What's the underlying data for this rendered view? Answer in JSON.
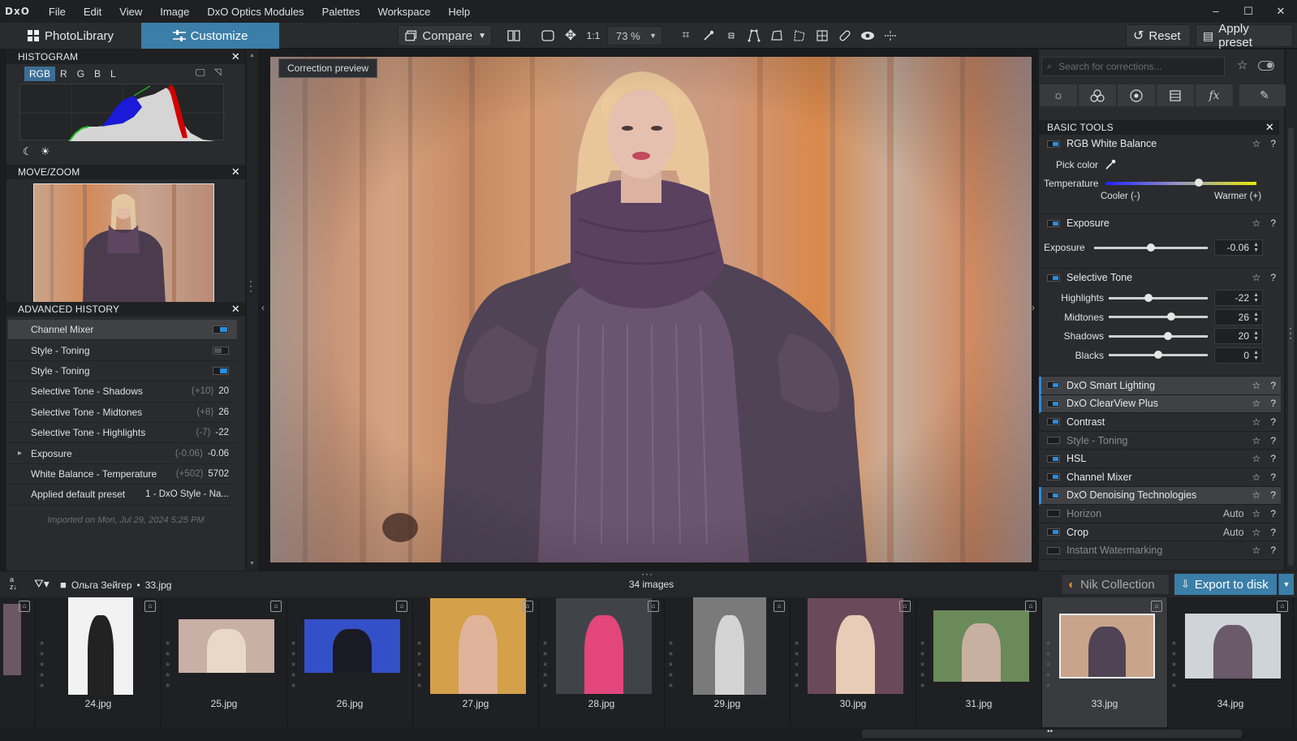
{
  "app": {
    "logo": "DxO"
  },
  "menu": [
    "File",
    "Edit",
    "View",
    "Image",
    "DxO Optics Modules",
    "Palettes",
    "Workspace",
    "Help"
  ],
  "window_controls": [
    "–",
    "☐",
    "✕"
  ],
  "toolbar": {
    "photolibrary": "PhotoLibrary",
    "customize": "Customize",
    "compare": "Compare",
    "one_to_one": "1:1",
    "zoom": "73 %",
    "reset": "Reset",
    "apply_preset": "Apply preset"
  },
  "histogram": {
    "title": "HISTOGRAM",
    "channels": [
      "RGB",
      "R",
      "G",
      "B",
      "L"
    ]
  },
  "movezoom": {
    "title": "MOVE/ZOOM"
  },
  "history": {
    "title": "ADVANCED HISTORY",
    "items": [
      {
        "name": "Channel Mixer",
        "delta": "",
        "value": "",
        "toggle": "on"
      },
      {
        "name": "Style - Toning",
        "delta": "",
        "value": "",
        "toggle": "off"
      },
      {
        "name": "Style - Toning",
        "delta": "",
        "value": "",
        "toggle": "on"
      },
      {
        "name": "Selective Tone - Shadows",
        "delta": "(+10)",
        "value": "20",
        "toggle": ""
      },
      {
        "name": "Selective Tone - Midtones",
        "delta": "(+8)",
        "value": "26",
        "toggle": ""
      },
      {
        "name": "Selective Tone - Highlights",
        "delta": "(-7)",
        "value": "-22",
        "toggle": ""
      },
      {
        "name": "Exposure",
        "delta": "(-0.06)",
        "value": "-0.06",
        "toggle": ""
      },
      {
        "name": "White Balance - Temperature",
        "delta": "(+502)",
        "value": "5702",
        "toggle": ""
      },
      {
        "name": "Applied default preset",
        "delta": "",
        "value": "1 - DxO Style - Na...",
        "toggle": ""
      }
    ],
    "imported": "Imported on Mon, Jul 29, 2024 5:25 PM"
  },
  "viewer": {
    "correction_preview": "Correction preview"
  },
  "right": {
    "search_placeholder": "Search for corrections...",
    "basic_tools": "BASIC TOOLS",
    "wb": {
      "title": "RGB White Balance",
      "pick": "Pick color",
      "temperature": "Temperature",
      "cooler": "Cooler (-)",
      "warmer": "Warmer (+)",
      "temp_pos": 0.62
    },
    "exposure": {
      "title": "Exposure",
      "label": "Exposure",
      "value": "-0.06",
      "pos": 0.5
    },
    "selective": {
      "title": "Selective Tone",
      "rows": [
        {
          "label": "Highlights",
          "value": "-22",
          "pos": 0.4
        },
        {
          "label": "Midtones",
          "value": "26",
          "pos": 0.63
        },
        {
          "label": "Shadows",
          "value": "20",
          "pos": 0.6
        },
        {
          "label": "Blacks",
          "value": "0",
          "pos": 0.5
        }
      ]
    },
    "tools": [
      {
        "name": "DxO Smart Lighting",
        "auto": "",
        "hl": true,
        "on": true,
        "dim": false
      },
      {
        "name": "DxO ClearView Plus",
        "auto": "",
        "hl": true,
        "on": true,
        "dim": false
      },
      {
        "name": "Contrast",
        "auto": "",
        "hl": false,
        "on": true,
        "dim": false
      },
      {
        "name": "Style - Toning",
        "auto": "",
        "hl": false,
        "on": false,
        "dim": true
      },
      {
        "name": "HSL",
        "auto": "",
        "hl": false,
        "on": true,
        "dim": false
      },
      {
        "name": "Channel Mixer",
        "auto": "",
        "hl": false,
        "on": true,
        "dim": false
      },
      {
        "name": "DxO Denoising Technologies",
        "auto": "",
        "hl": true,
        "on": true,
        "dim": false
      },
      {
        "name": "Horizon",
        "auto": "Auto",
        "hl": false,
        "on": false,
        "dim": true
      },
      {
        "name": "Crop",
        "auto": "Auto",
        "hl": false,
        "on": true,
        "dim": false
      },
      {
        "name": "Instant Watermarking",
        "auto": "",
        "hl": false,
        "on": false,
        "dim": true
      }
    ]
  },
  "filmstrip": {
    "folder": "Ольга Зейгер",
    "file": "33.jpg",
    "count": "34 images",
    "nik": "Nik Collection",
    "export": "Export to disk",
    "items": [
      "24.jpg",
      "25.jpg",
      "26.jpg",
      "27.jpg",
      "28.jpg",
      "29.jpg",
      "30.jpg",
      "31.jpg",
      "33.jpg",
      "34.jpg"
    ],
    "selected_index": 8
  }
}
